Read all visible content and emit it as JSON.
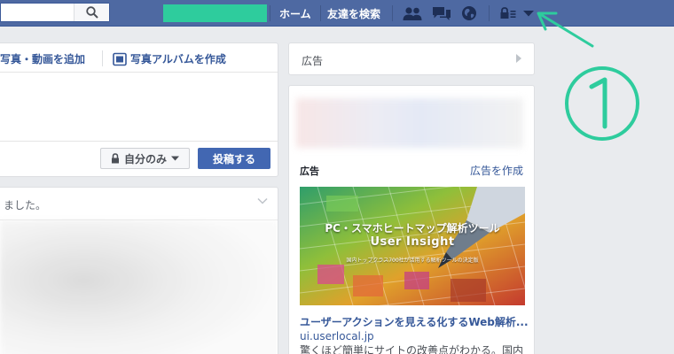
{
  "topbar": {
    "nav_home": "ホーム",
    "nav_find_friends": "友達を検索",
    "icons": [
      "search-icon",
      "friend-requests-icon",
      "messages-icon",
      "notifications-globe-icon",
      "privacy-lock-icon",
      "account-menu-arrow-icon"
    ]
  },
  "composer": {
    "action_photo_video": "写真・動画を追加",
    "action_create_album": "写真アルバムを作成",
    "privacy_label": "自分のみ",
    "post_button": "投稿する"
  },
  "feed": {
    "story_text": "ました。"
  },
  "right_column": {
    "ad_header": "広告",
    "sponsored_label": "広告",
    "create_ad_link": "広告を作成",
    "ad_image": {
      "headline": "PC・スマホヒートマップ解析ツール",
      "product": "User Insight",
      "caption": "国内トップクラス700社が活用する解析ツールの決定版"
    },
    "ad_title": "ユーザーアクションを見える化するWeb解析...",
    "ad_url": "ui.userlocal.jp",
    "ad_description": "驚くほど簡単にサイトの改善点がわかる。国内"
  },
  "annotation": {
    "marker": "①",
    "color": "#2ecc9d"
  },
  "colors": {
    "topbar": "#4e69a2",
    "link": "#365899",
    "primary_button": "#4267b2",
    "page_background": "#e9ebee"
  }
}
